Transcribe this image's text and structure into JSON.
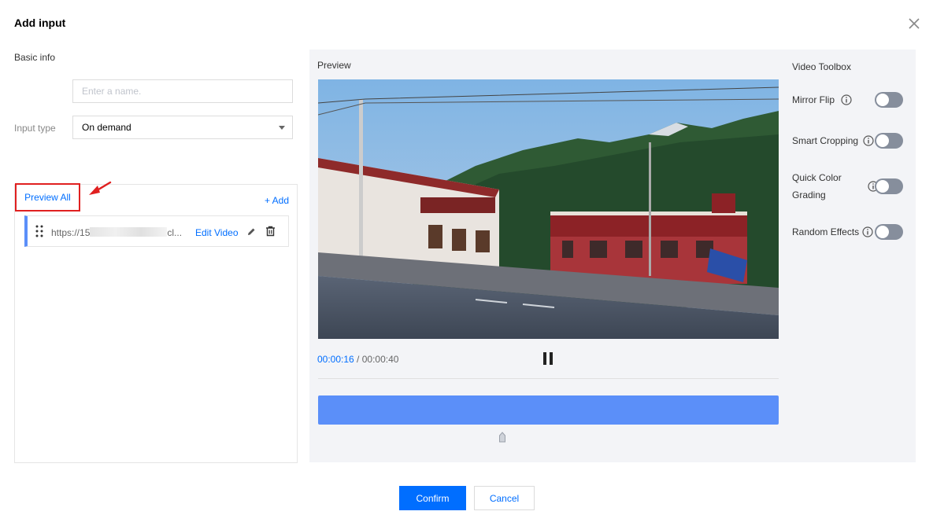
{
  "dialog": {
    "title": "Add input",
    "close_icon": "close-icon"
  },
  "basic_info": {
    "section_label": "Basic info",
    "name_placeholder": "Enter a name.",
    "name_value": "",
    "input_type_label": "Input type",
    "input_type_value": "On demand"
  },
  "input_list": {
    "preview_all_label": "Preview All",
    "add_label": "+ Add",
    "items": [
      {
        "url_prefix": "https://15",
        "url_suffix": "cl...",
        "edit_label": "Edit Video",
        "icons": [
          "drag-handle-icon",
          "pencil-icon",
          "trash-icon"
        ]
      }
    ]
  },
  "preview": {
    "label": "Preview",
    "current_time": "00:00:16",
    "separator": " / ",
    "total_time": "00:00:40",
    "progress_fraction": 0.4,
    "pause_icon": "pause-icon"
  },
  "toolbox": {
    "title": "Video Toolbox",
    "tools": [
      {
        "label": "Mirror Flip",
        "enabled": false
      },
      {
        "label": "Smart Cropping",
        "enabled": false
      },
      {
        "label_line1": "Quick Color",
        "label_line2": "Grading",
        "enabled": false
      },
      {
        "label": "Random Effects",
        "enabled": false
      }
    ]
  },
  "footer": {
    "confirm_label": "Confirm",
    "cancel_label": "Cancel"
  },
  "colors": {
    "accent": "#006eff",
    "track": "#5b8ff9",
    "highlight_border": "#e02020",
    "toggle_off": "#868e9c"
  }
}
